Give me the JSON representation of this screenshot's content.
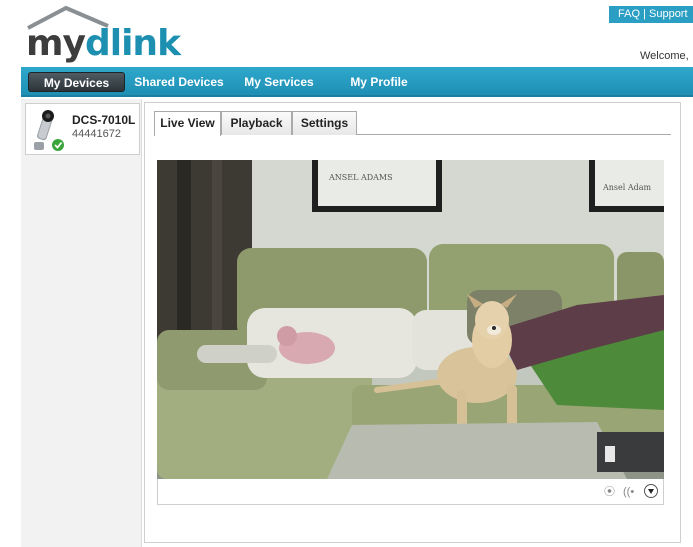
{
  "brand": {
    "my": "my",
    "dlink": "dlink"
  },
  "header": {
    "faq": "FAQ",
    "separator": "|",
    "support": "Support",
    "welcome": "Welcome,"
  },
  "nav": {
    "tabs": [
      {
        "label": "My Devices",
        "active": true
      },
      {
        "label": "Shared Devices"
      },
      {
        "label": "My Services"
      },
      {
        "label": "My Profile"
      }
    ]
  },
  "sidebar": {
    "devices": [
      {
        "name": "DCS-7010L",
        "id": "44441672",
        "status": "online",
        "icon": "camera-icon"
      }
    ]
  },
  "main": {
    "tabs": [
      {
        "label": "Live View",
        "active": true
      },
      {
        "label": "Playback"
      },
      {
        "label": "Settings"
      }
    ],
    "video": {
      "poster_left": "ANSEL ADAMS",
      "poster_right": "Ansel Adam"
    },
    "controls": {
      "record_icon": "record-icon",
      "audio_icon": "audio-icon",
      "menu_icon": "menu-down-icon"
    }
  },
  "colors": {
    "accent": "#2a9ec3",
    "nav_active": "#3a444a",
    "status_ok": "#3aa53a"
  }
}
